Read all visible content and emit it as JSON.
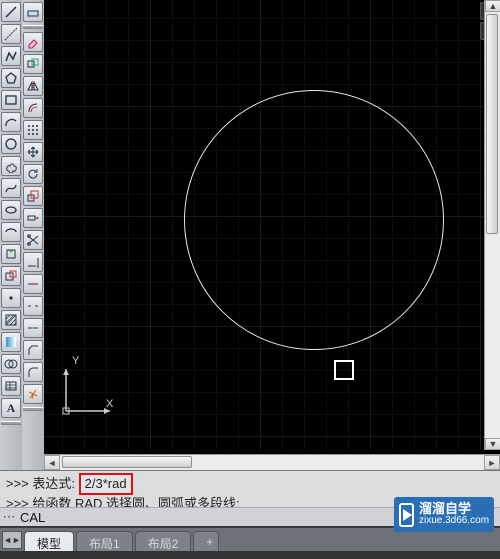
{
  "tools_left": [
    {
      "name": "line-tool"
    },
    {
      "name": "construction-line-tool"
    },
    {
      "name": "polyline-tool"
    },
    {
      "name": "polygon-tool"
    },
    {
      "name": "rectangle-tool"
    },
    {
      "name": "arc-tool"
    },
    {
      "name": "circle-tool"
    },
    {
      "name": "revision-cloud-tool"
    },
    {
      "name": "spline-tool"
    },
    {
      "name": "ellipse-tool"
    },
    {
      "name": "ellipse-arc-tool"
    },
    {
      "name": "insert-block-tool"
    },
    {
      "name": "make-block-tool"
    },
    {
      "name": "point-tool"
    },
    {
      "name": "hatch-tool"
    },
    {
      "name": "gradient-tool"
    },
    {
      "name": "region-tool"
    },
    {
      "name": "table-tool"
    },
    {
      "name": "mtext-tool",
      "label": "A"
    }
  ],
  "tools_right": [
    {
      "name": "props-unknown-1"
    },
    {
      "name": "erase-tool"
    },
    {
      "name": "copy-tool"
    },
    {
      "name": "mirror-tool"
    },
    {
      "name": "offset-tool"
    },
    {
      "name": "array-tool"
    },
    {
      "name": "move-tool"
    },
    {
      "name": "rotate-tool"
    },
    {
      "name": "scale-tool"
    },
    {
      "name": "stretch-tool"
    },
    {
      "name": "trim-tool"
    },
    {
      "name": "extend-tool"
    },
    {
      "name": "break-at-point-tool"
    },
    {
      "name": "break-tool"
    },
    {
      "name": "join-tool"
    },
    {
      "name": "chamfer-tool"
    },
    {
      "name": "fillet-tool"
    },
    {
      "name": "explode-tool"
    }
  ],
  "ucs": {
    "x_label": "X",
    "y_label": "Y"
  },
  "command": {
    "line1_prefix": ">>> 表达式:",
    "line1_expr": "2/3*rad",
    "line2": ">>> 给函数 RAD 选择圆、圆弧或多段线:",
    "prompt_icon": "⋯",
    "input_value": "CAL"
  },
  "tabs": {
    "items": [
      {
        "label": "模型",
        "active": true
      },
      {
        "label": "布局1",
        "active": false
      },
      {
        "label": "布局2",
        "active": false
      }
    ],
    "plus": "+"
  },
  "watermark": {
    "brand": "溜溜自学",
    "url": "zixue.3d66.com"
  }
}
